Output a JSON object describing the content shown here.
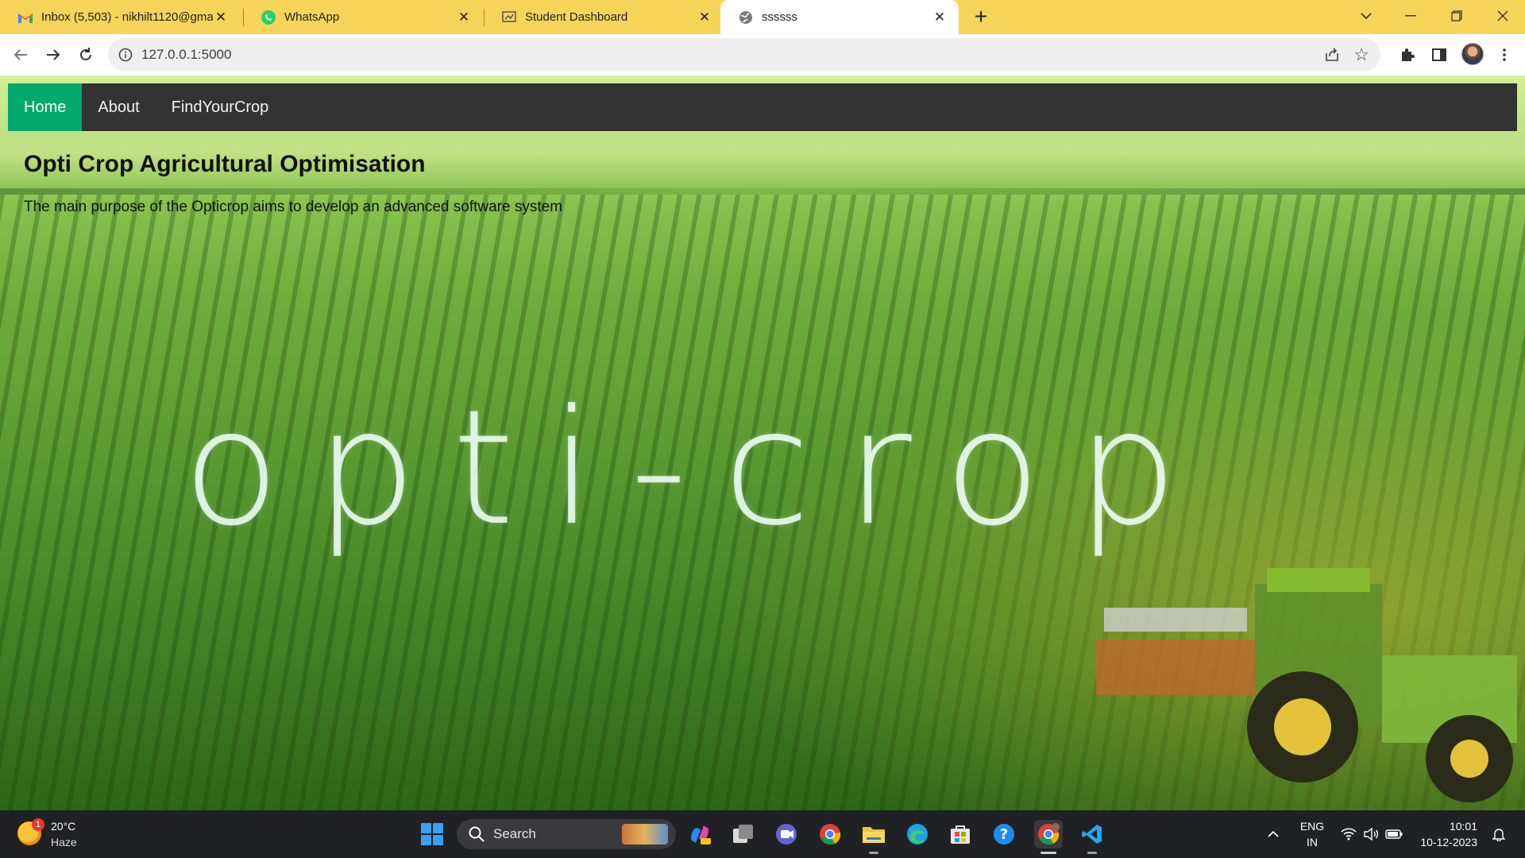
{
  "browser": {
    "tabs": [
      {
        "title": "Inbox (5,503) - nikhilt1120@gma",
        "icon": "gmail-icon",
        "active": false
      },
      {
        "title": "WhatsApp",
        "icon": "whatsapp-icon",
        "active": false
      },
      {
        "title": "Student Dashboard",
        "icon": "dashboard-icon",
        "active": false
      },
      {
        "title": "ssssss",
        "icon": "globe-icon",
        "active": true
      }
    ],
    "url": "127.0.0.1:5000"
  },
  "page": {
    "nav": [
      {
        "label": "Home",
        "active": true
      },
      {
        "label": "About",
        "active": false
      },
      {
        "label": "FindYourCrop",
        "active": false
      }
    ],
    "title": "Opti Crop Agricultural Optimisation",
    "description": "The main purpose of the Opticrop aims to develop an advanced software system",
    "hero_word": "opti-crop",
    "accent_color": "#04aa6d",
    "nav_bg": "#333333"
  },
  "taskbar": {
    "weather": {
      "temp": "20°C",
      "condition": "Haze",
      "badge": "1"
    },
    "search_label": "Search",
    "language": {
      "line1": "ENG",
      "line2": "IN"
    },
    "clock": {
      "time": "10:01",
      "date": "10-12-2023"
    }
  }
}
